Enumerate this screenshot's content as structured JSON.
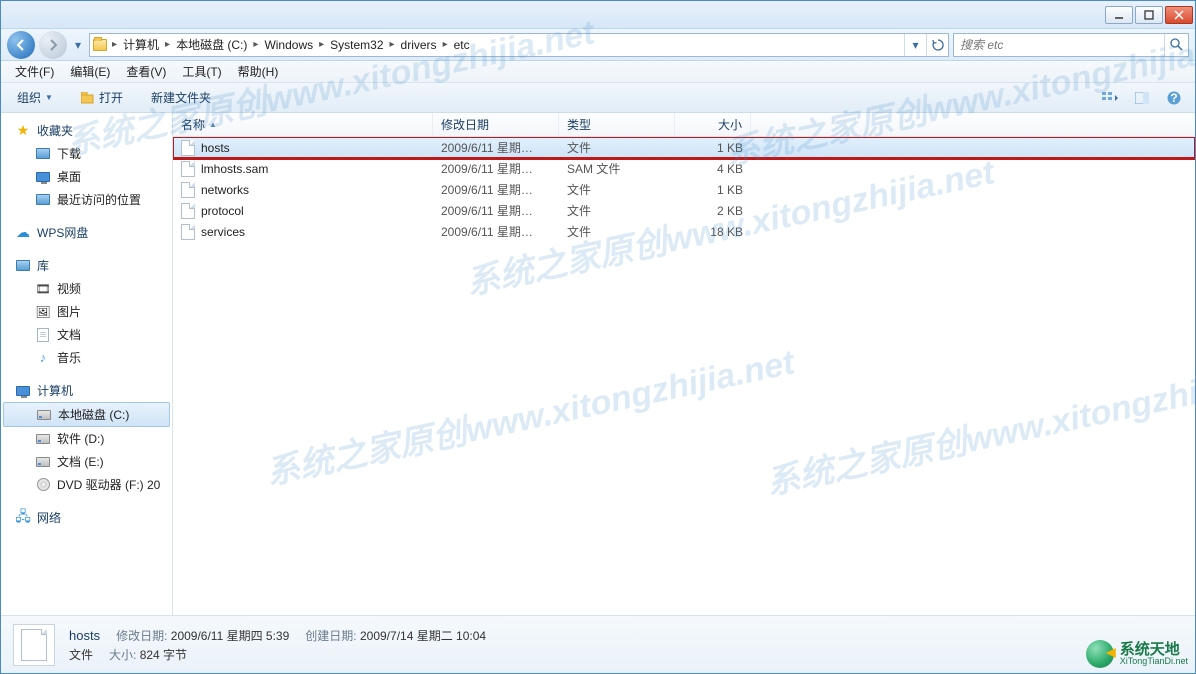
{
  "titlebar": {},
  "nav": {
    "breadcrumb": [
      "计算机",
      "本地磁盘 (C:)",
      "Windows",
      "System32",
      "drivers",
      "etc"
    ]
  },
  "search": {
    "placeholder": "搜索 etc"
  },
  "menubar": [
    "文件(F)",
    "编辑(E)",
    "查看(V)",
    "工具(T)",
    "帮助(H)"
  ],
  "toolbar": {
    "organize": "组织",
    "open": "打开",
    "newfolder": "新建文件夹"
  },
  "sidebar": {
    "favorites": {
      "head": "收藏夹",
      "items": [
        "下载",
        "桌面",
        "最近访问的位置"
      ]
    },
    "wps": {
      "head": "WPS网盘"
    },
    "libs": {
      "head": "库",
      "items": [
        "视频",
        "图片",
        "文档",
        "音乐"
      ]
    },
    "computer": {
      "head": "计算机",
      "items": [
        "本地磁盘 (C:)",
        "软件 (D:)",
        "文档 (E:)",
        "DVD 驱动器 (F:) 20"
      ]
    },
    "network": {
      "head": "网络"
    }
  },
  "columns": {
    "name": "名称",
    "date": "修改日期",
    "type": "类型",
    "size": "大小"
  },
  "files": [
    {
      "name": "hosts",
      "date": "2009/6/11 星期…",
      "type": "文件",
      "size": "1 KB",
      "selected": true,
      "highlighted": true
    },
    {
      "name": "lmhosts.sam",
      "date": "2009/6/11 星期…",
      "type": "SAM 文件",
      "size": "4 KB"
    },
    {
      "name": "networks",
      "date": "2009/6/11 星期…",
      "type": "文件",
      "size": "1 KB"
    },
    {
      "name": "protocol",
      "date": "2009/6/11 星期…",
      "type": "文件",
      "size": "2 KB"
    },
    {
      "name": "services",
      "date": "2009/6/11 星期…",
      "type": "文件",
      "size": "18 KB"
    }
  ],
  "details": {
    "name": "hosts",
    "mod_label": "修改日期:",
    "mod_val": "2009/6/11 星期四 5:39",
    "create_label": "创建日期:",
    "create_val": "2009/7/14 星期二 10:04",
    "type": "文件",
    "size_label": "大小:",
    "size_val": "824 字节"
  },
  "watermark": "系统之家原创www.xitongzhijia.net",
  "brand": {
    "cn": "系统天地",
    "en": "XiTongTianDi.net"
  }
}
